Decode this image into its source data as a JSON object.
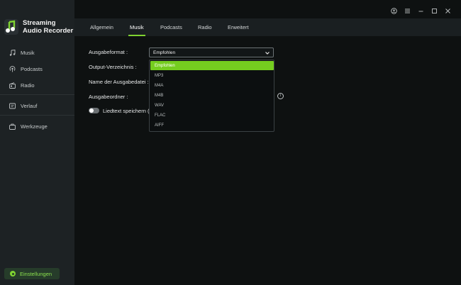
{
  "brand": {
    "title_line1": "Streaming",
    "title_line2": "Audio Recorder"
  },
  "sidebar": {
    "items": [
      {
        "label": "Musik",
        "icon": "music-note-icon"
      },
      {
        "label": "Podcasts",
        "icon": "podcast-icon"
      },
      {
        "label": "Radio",
        "icon": "radio-icon"
      },
      {
        "label": "Verlauf",
        "icon": "history-icon"
      },
      {
        "label": "Werkzeuge",
        "icon": "toolbox-icon"
      }
    ],
    "settings_label": "Einstellungen"
  },
  "window_controls": [
    "account-icon",
    "menu-icon",
    "minimize-icon",
    "maximize-icon",
    "close-icon"
  ],
  "tabs": [
    {
      "label": "Allgemein",
      "active": false
    },
    {
      "label": "Musik",
      "active": true
    },
    {
      "label": "Podcasts",
      "active": false
    },
    {
      "label": "Radio",
      "active": false
    },
    {
      "label": "Erweitert",
      "active": false
    }
  ],
  "form": {
    "output_format_label": "Ausgabeformat :",
    "output_format_value": "Empfohlen",
    "output_dir_label": "Output-Verzeichnis :",
    "filename_label": "Name der Ausgabedatei :",
    "output_folder_label": "Ausgabeordner :",
    "lyrics_label": "Liedtext speichern (f",
    "lyrics_enabled": false
  },
  "dropdown": {
    "options": [
      "Empfohlen",
      "MP3",
      "M4A",
      "M4B",
      "WAV",
      "FLAC",
      "AIFF"
    ],
    "selected": "Empfohlen"
  },
  "colors": {
    "accent": "#75cd1f",
    "sidebar_bg": "#1d2224",
    "main_bg": "#0e1111"
  }
}
